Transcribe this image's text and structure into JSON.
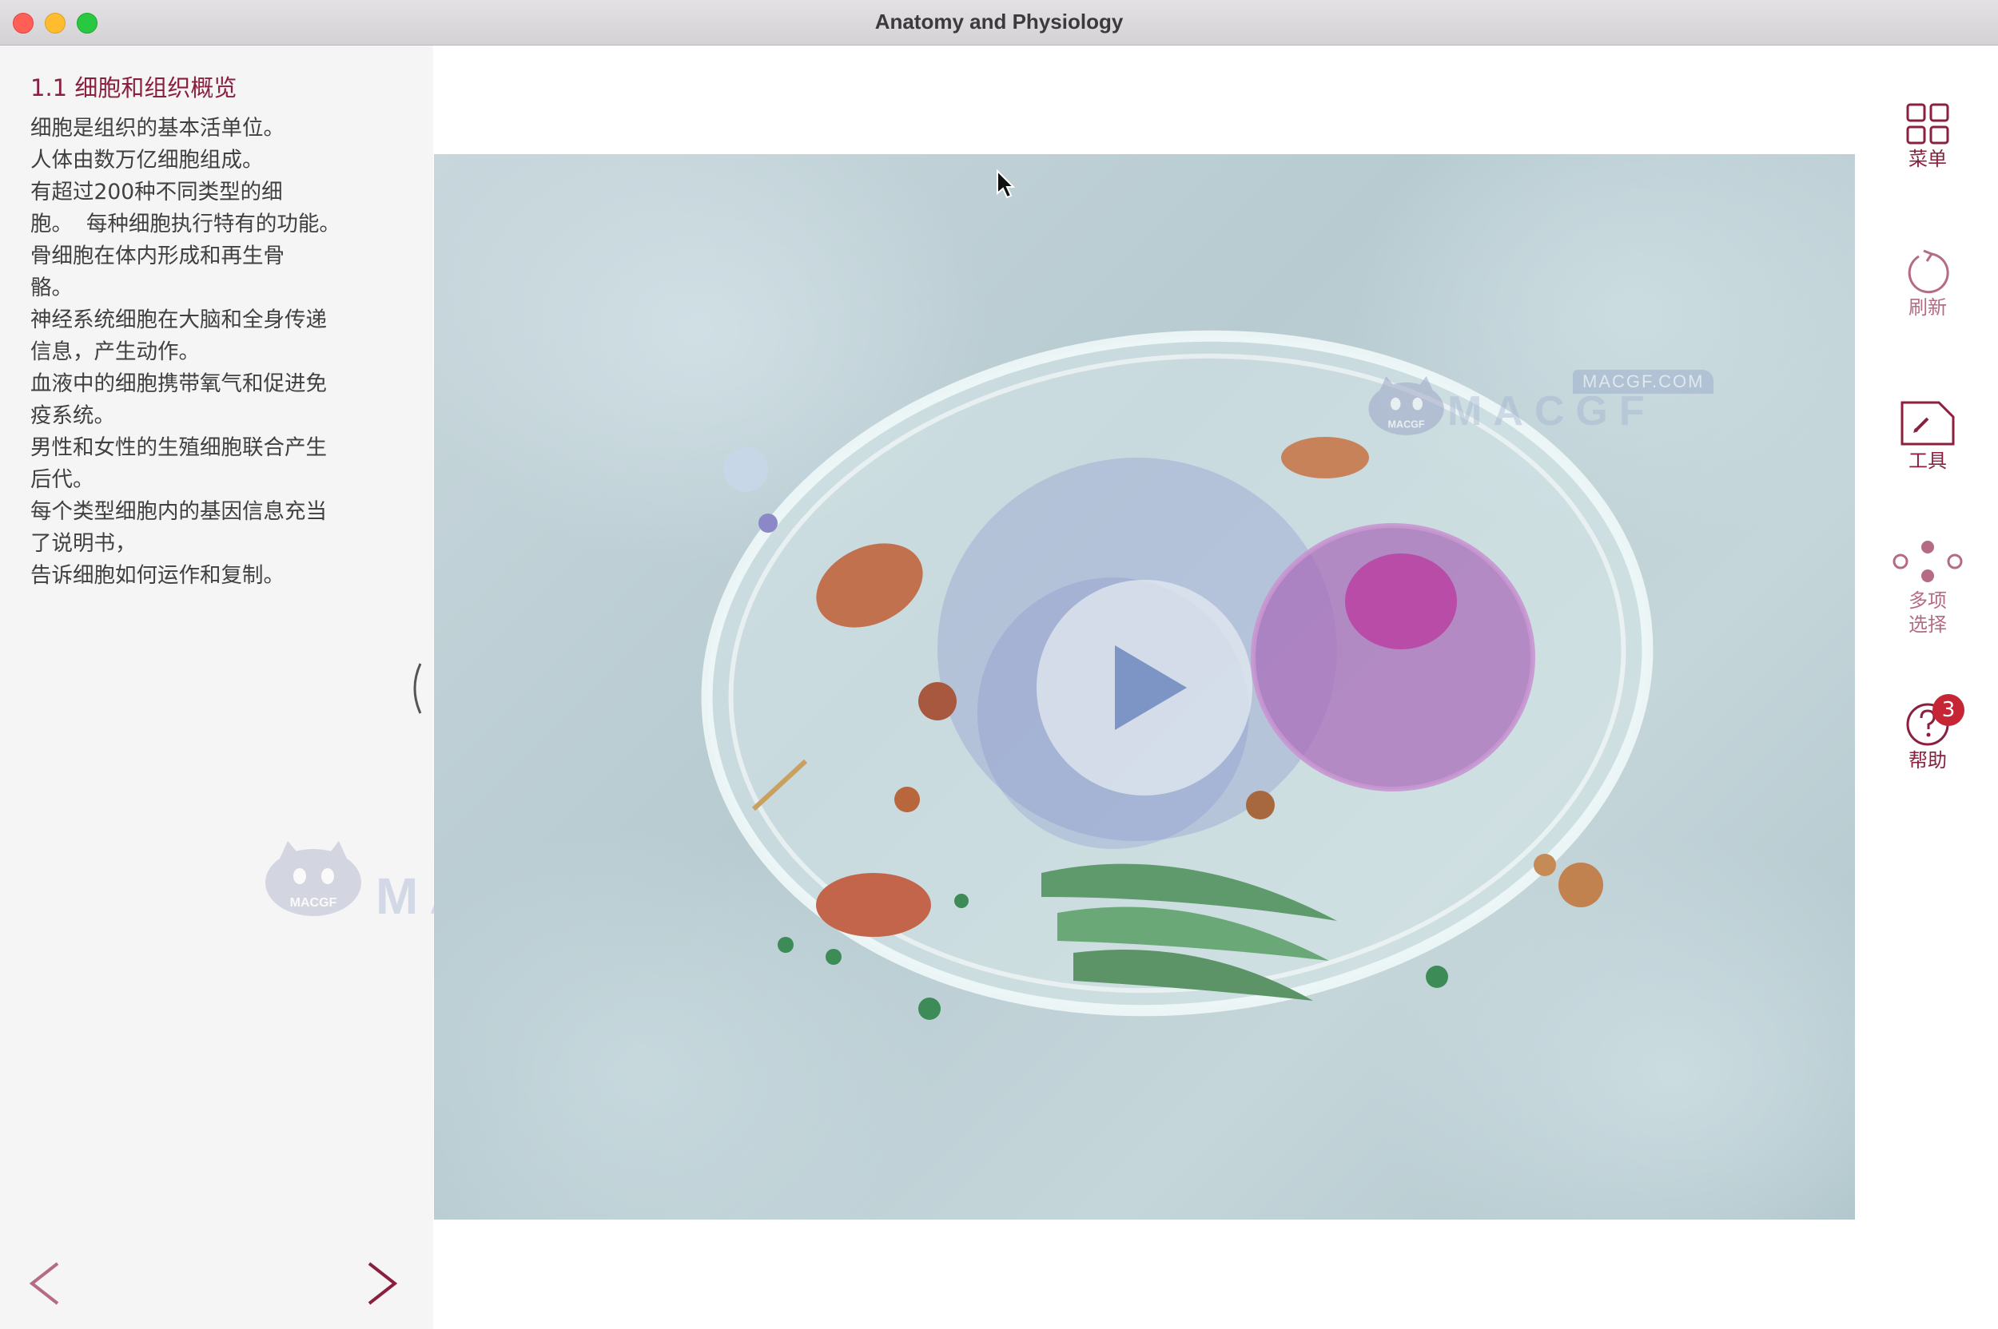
{
  "window": {
    "title": "Anatomy and Physiology"
  },
  "sidebar": {
    "section_title": "1.1  细胞和组织概览",
    "lines": [
      "细胞是组织的基本活单位。",
      "人体由数万亿细胞组成。",
      "有超过200种不同类型的细",
      "胞。  每种细胞执行特有的功能。",
      "骨细胞在体内形成和再生骨",
      "骼。",
      "神经系统细胞在大脑和全身传递",
      "信息，产生动作。",
      "血液中的细胞携带氧气和促进免",
      "疫系统。",
      "男性和女性的生殖细胞联合产生",
      "后代。",
      "每个类型细胞内的基因信息充当",
      "了说明书，",
      "告诉细胞如何运作和复制。"
    ],
    "prev_label": "<",
    "next_label": ">"
  },
  "watermark": {
    "site": "MACGF.COM",
    "brand": "MACGF",
    "mascot": "MACGF"
  },
  "toolbar": {
    "menu_label": "菜单",
    "refresh_label": "刷新",
    "tools_label": "工具",
    "multi_select_label_1": "多项",
    "multi_select_label_2": "选择",
    "help_label": "帮助",
    "help_badge": "3"
  },
  "colors": {
    "accent": "#8b1f3e",
    "refresh_muted": "#b56a85",
    "badge": "#c62536"
  }
}
